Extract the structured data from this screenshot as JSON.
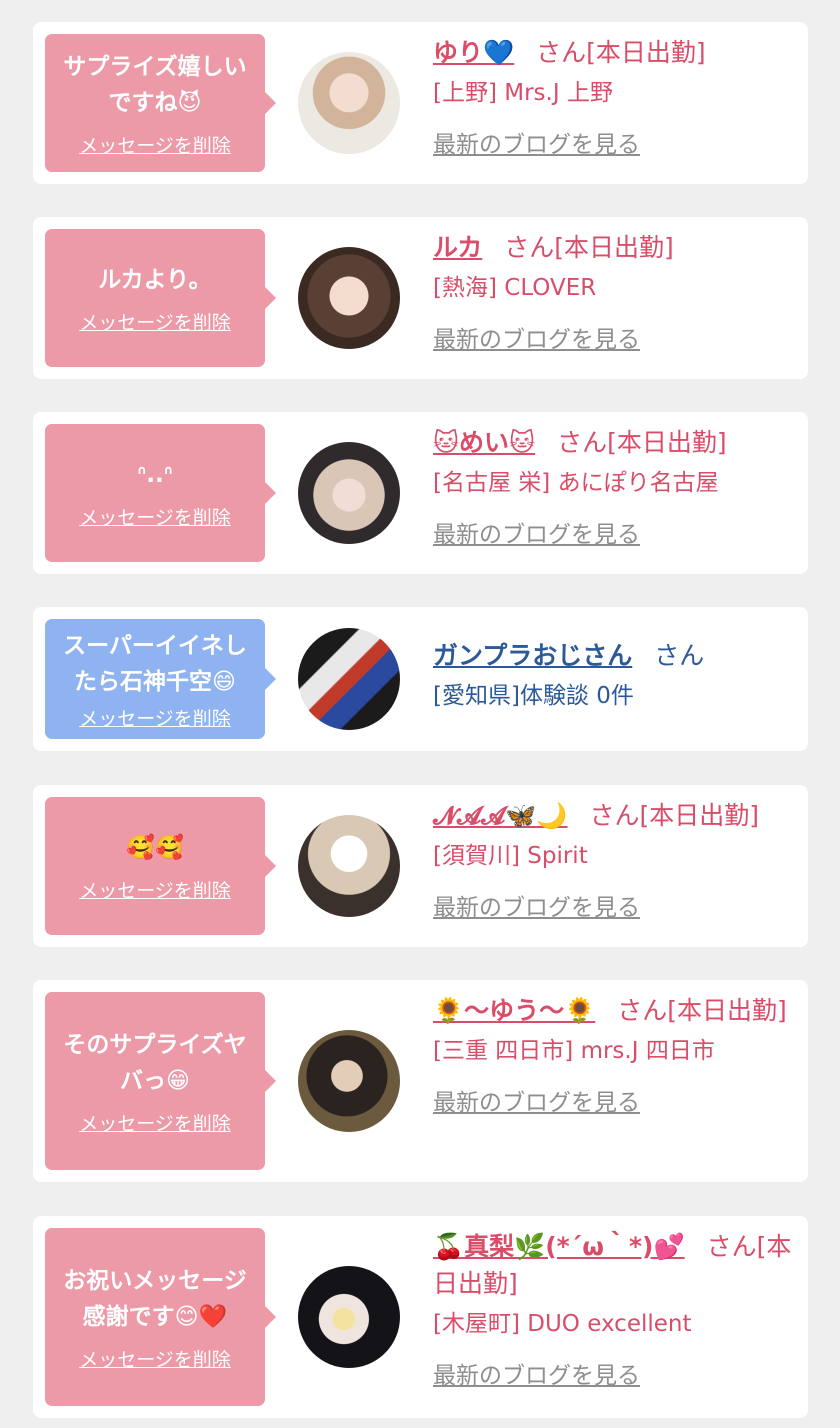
{
  "colors": {
    "accent_pink": "#d94d69",
    "accent_blue": "#2c5a98",
    "bubble_pink": "#ed9aa8",
    "bubble_blue": "#8fb3f1",
    "blog_link_gray": "#8e8e8e"
  },
  "cards": [
    {
      "bubble_text": "サプライズ嬉しい\nですね",
      "bubble_emoji": "😈",
      "delete_label": "メッセージを削除",
      "name": "ゆり💙",
      "suffix": "さん[本日出勤]",
      "shop": "[上野] Mrs.J 上野",
      "blog_label": "最新のブログを見る"
    },
    {
      "bubble_text": "ルカより。",
      "bubble_emoji": "",
      "delete_label": "メッセージを削除",
      "name": "ルカ",
      "suffix": "さん[本日出勤]",
      "shop": "[熱海] CLOVER",
      "blog_label": "最新のブログを見る"
    },
    {
      "bubble_text": "ᐢ..ᐢ",
      "bubble_emoji": "",
      "delete_label": "メッセージを削除",
      "name": "🐱めい🐱",
      "suffix": "さん[本日出勤]",
      "shop": "[名古屋 栄] あにぽり名古屋",
      "blog_label": "最新のブログを見る"
    },
    {
      "bubble_text": "スーパーイイネし\nたら石神千空",
      "bubble_emoji": "😄",
      "delete_label": "メッセージを削除",
      "name": "ガンプラおじさん",
      "suffix": "さん",
      "shop": "[愛知県]体験談 0件",
      "blog_label": ""
    },
    {
      "bubble_text": "🥰🥰",
      "bubble_emoji": "",
      "delete_label": "メッセージを削除",
      "name": "𝓝𝓐𝓐🦋🌙",
      "suffix": "さん[本日出勤]",
      "shop": "[須賀川] Spirit",
      "blog_label": "最新のブログを見る"
    },
    {
      "bubble_text": "そのサプライズヤ\nバっ",
      "bubble_emoji": "😁",
      "delete_label": "メッセージを削除",
      "name": "🌻〜ゆう〜🌻",
      "suffix": "さん[本日出勤]",
      "shop": "[三重 四日市] mrs.J 四日市",
      "blog_label": "最新のブログを見る"
    },
    {
      "bubble_text": "お祝いメッセージ\n感謝です",
      "bubble_emoji": "😊❤️",
      "delete_label": "メッセージを削除",
      "name": "🍒真梨🌿(*´ω｀*)💕",
      "suffix": "さん[本日出勤]",
      "shop": "[木屋町] DUO excellent",
      "blog_label": "最新のブログを見る"
    }
  ]
}
